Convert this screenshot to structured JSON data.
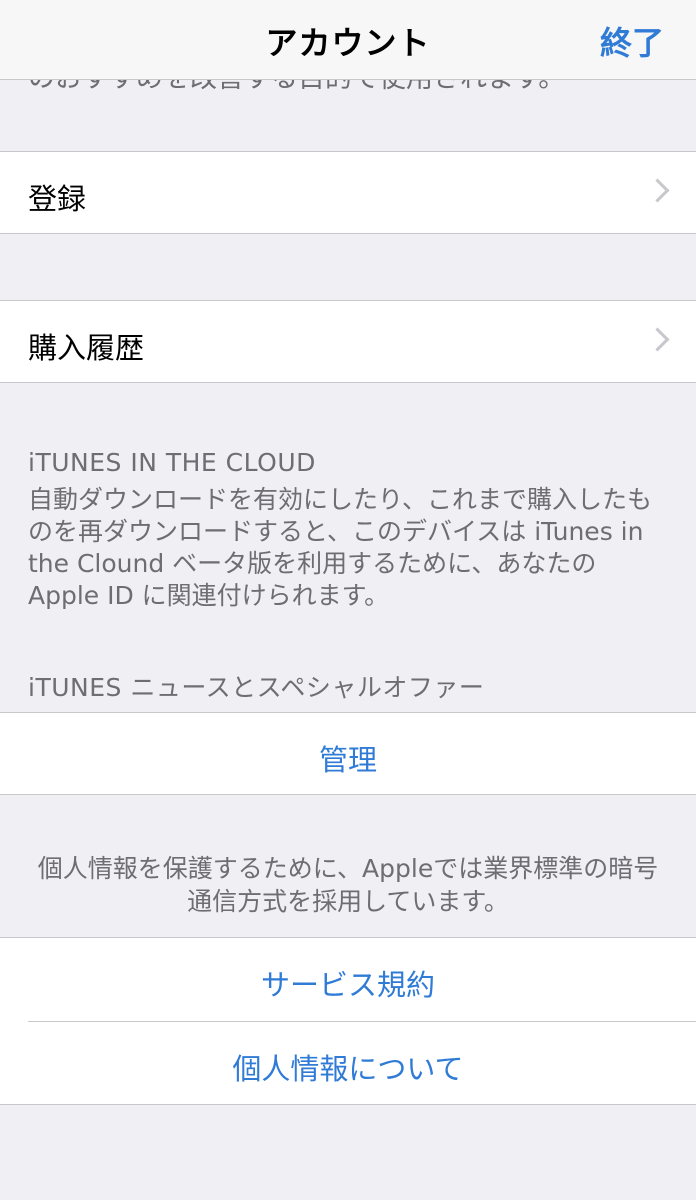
{
  "navbar": {
    "title": "アカウント",
    "done_label": "終了"
  },
  "top_cut_text": "のおすすめを改善する目的で使用されます。",
  "cells": {
    "register": "登録",
    "purchase_history": "購入履歴"
  },
  "itunes_cloud": {
    "header": "iTUNES IN THE CLOUD",
    "description": "自動ダウンロードを有効にしたり、これまで購入したものを再ダウンロードすると、このデバイスは iTunes in the Clound ベータ版を利用するために、あなたの Apple ID に関連付けられます。"
  },
  "itunes_news": {
    "header": "iTUNES ニュースとスペシャルオファー",
    "manage_label": "管理"
  },
  "privacy_note": "個人情報を保護するために、Appleでは業界標準の暗号通信方式を採用しています。",
  "links": {
    "terms": "サービス規約",
    "privacy": "個人情報について"
  },
  "colors": {
    "accent": "#2f7bd6",
    "background": "#efeff4",
    "secondary_text": "#6d6d72"
  }
}
